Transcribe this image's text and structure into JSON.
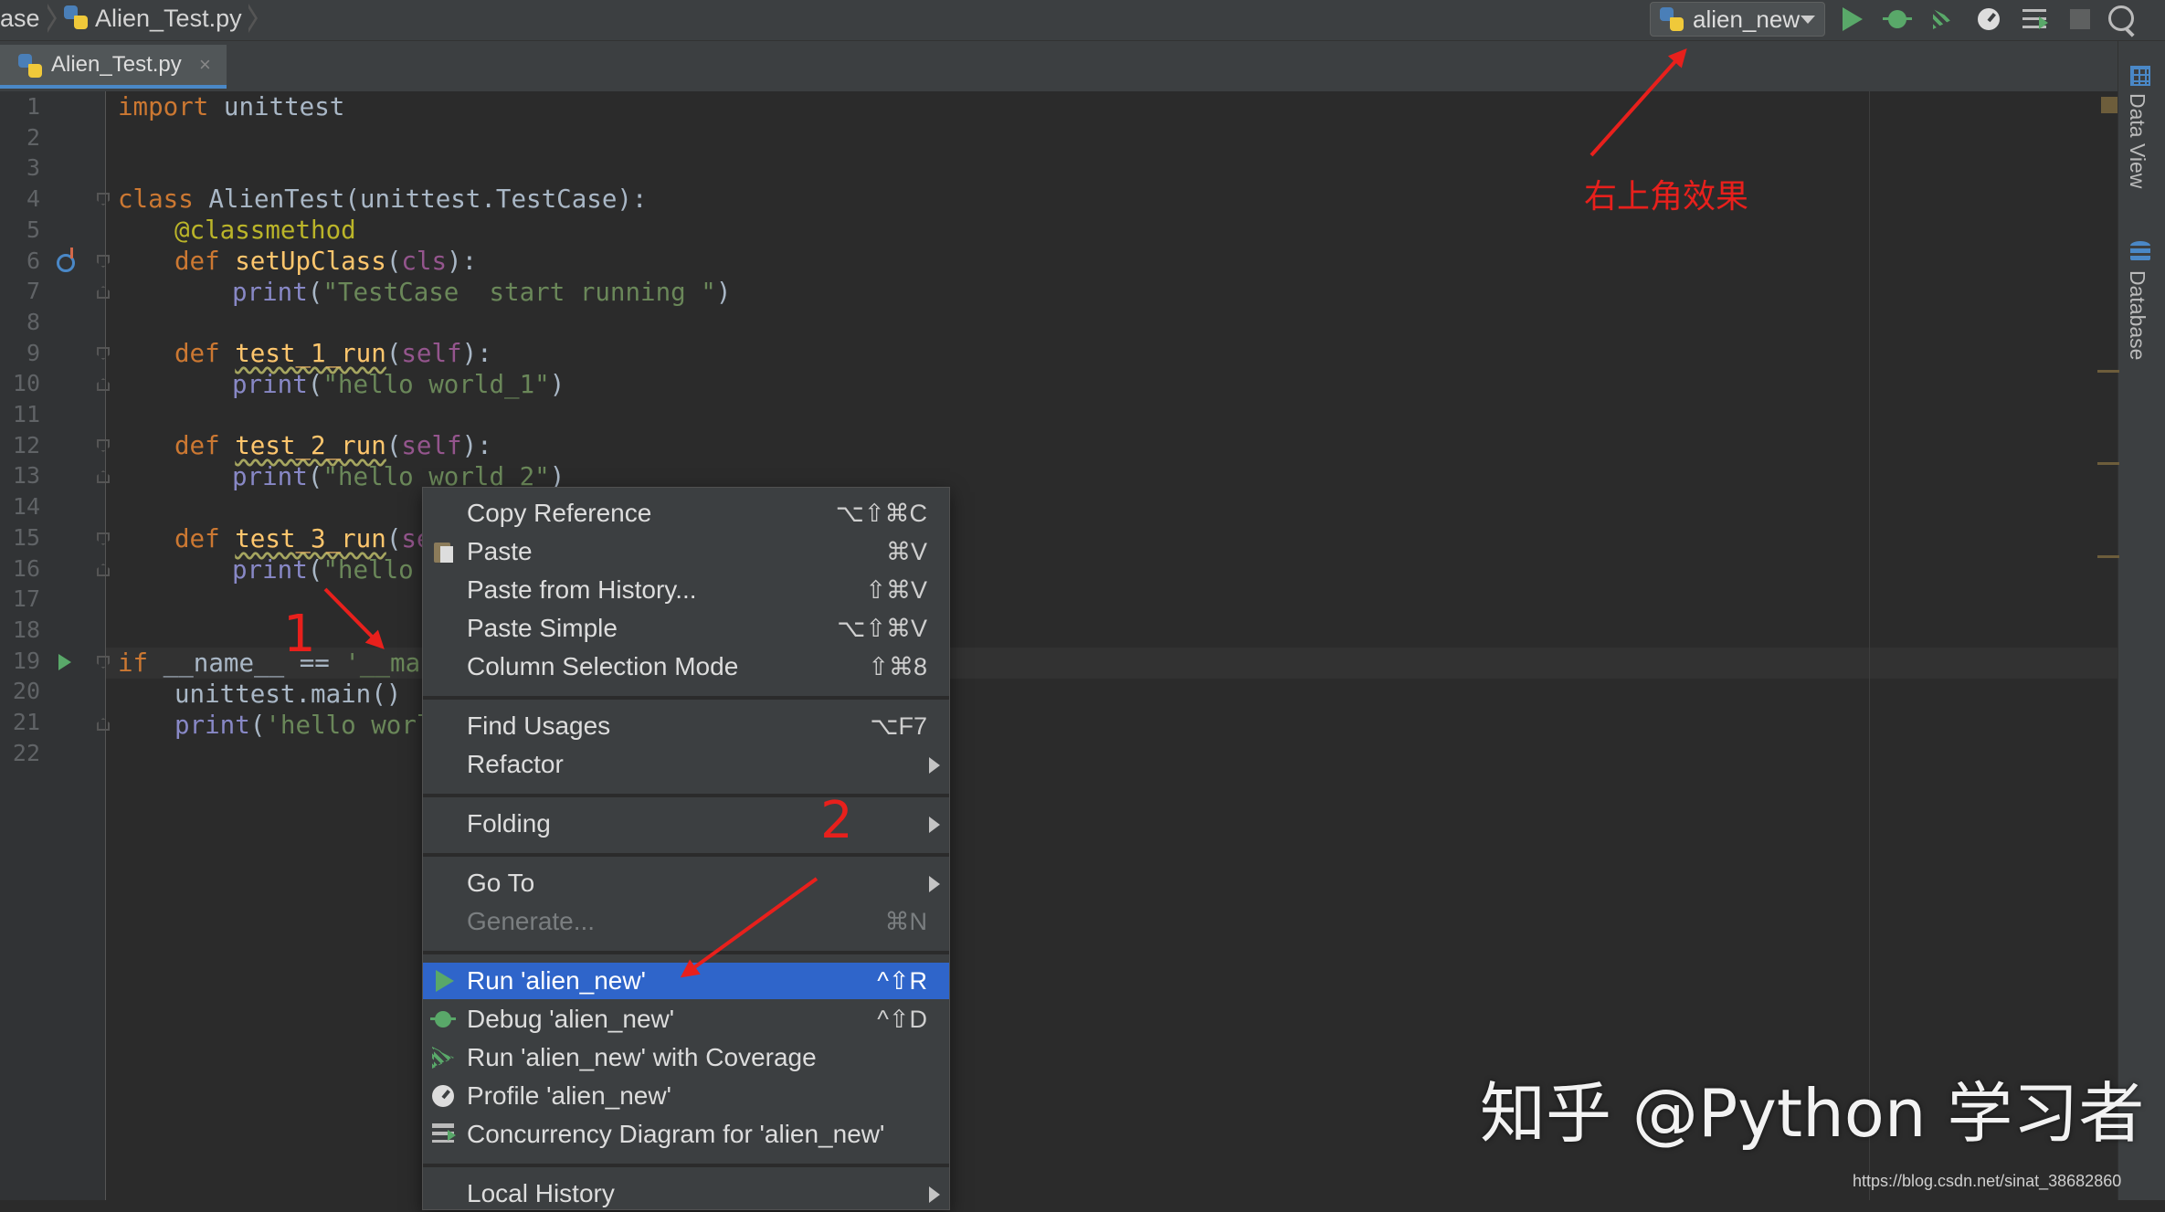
{
  "breadcrumb": {
    "prefix": "ase",
    "file": "Alien_Test.py"
  },
  "toolbar": {
    "run_config": "alien_new",
    "buttons": [
      "run-icon",
      "debug-icon",
      "coverage-icon",
      "profile-icon",
      "concurrency-icon",
      "stop-icon",
      "search-icon"
    ]
  },
  "tab": {
    "label": "Alien_Test.py",
    "close": "×"
  },
  "right_tool_windows": [
    "Data View",
    "Database"
  ],
  "line_numbers": [
    "1",
    "2",
    "3",
    "4",
    "5",
    "6",
    "7",
    "8",
    "9",
    "10",
    "11",
    "12",
    "13",
    "14",
    "15",
    "16",
    "17",
    "18",
    "19",
    "20",
    "21",
    "22"
  ],
  "code": {
    "l1_kw": "import",
    "l1_rest": " unittest",
    "l4_kw": "class",
    "l4_rest": " AlienTest(unittest.TestCase):",
    "l5_dec": "@classmethod",
    "l6_kw": "def ",
    "l6_fn": "setUpClass",
    "l6_p1": "(",
    "l6_arg": "cls",
    "l6_p2": "):",
    "l7_bi": "print",
    "l7_p1": "(",
    "l7_str": "\"TestCase  start running \"",
    "l7_p2": ")",
    "l9_kw": "def ",
    "l9_fn": "test_1_run",
    "l9_p1": "(",
    "l9_arg": "self",
    "l9_p2": "):",
    "l10_bi": "print",
    "l10_p1": "(",
    "l10_str": "\"hello world_1\"",
    "l10_p2": ")",
    "l12_kw": "def ",
    "l12_fn": "test_2_run",
    "l12_p1": "(",
    "l12_arg": "self",
    "l12_p2": "):",
    "l13_bi": "print",
    "l13_p1": "(",
    "l13_str": "\"hello world_2\"",
    "l13_p2": ")",
    "l15_kw": "def ",
    "l15_fn": "test_3_run",
    "l15_p1": "(",
    "l15_arg": "se",
    "l16_bi": "print",
    "l16_p1": "(",
    "l16_str": "\"hello",
    "l19_kw": "if",
    "l19_rest": " __name__ == ",
    "l19_str": "'__mai",
    "l20": "unittest.main()",
    "l21_bi": "print",
    "l21_p1": "(",
    "l21_str": "'hello worl"
  },
  "context_menu": {
    "items": [
      {
        "label": "Copy Reference",
        "shortcut": "⌥⇧⌘C"
      },
      {
        "label": "Paste",
        "shortcut": "⌘V",
        "icon": "paste-icon"
      },
      {
        "label": "Paste from History...",
        "shortcut": "⇧⌘V"
      },
      {
        "label": "Paste Simple",
        "shortcut": "⌥⇧⌘V"
      },
      {
        "label": "Column Selection Mode",
        "shortcut": "⇧⌘8"
      },
      {
        "label": "Find Usages",
        "shortcut": "⌥F7"
      },
      {
        "label": "Refactor",
        "submenu": true
      },
      {
        "label": "Folding",
        "submenu": true
      },
      {
        "label": "Go To",
        "submenu": true
      },
      {
        "label": "Generate...",
        "shortcut": "⌘N",
        "disabled": true
      },
      {
        "label": "Run 'alien_new'",
        "shortcut": "^⇧R",
        "selected": true,
        "icon": "run-icon"
      },
      {
        "label": "Debug 'alien_new'",
        "shortcut": "^⇧D",
        "icon": "debug-icon"
      },
      {
        "label": "Run 'alien_new' with Coverage",
        "icon": "coverage-icon"
      },
      {
        "label": "Profile 'alien_new'",
        "icon": "profile-icon"
      },
      {
        "label": "Concurrency Diagram for  'alien_new'",
        "icon": "concurrency-icon"
      },
      {
        "label": "Local History",
        "submenu": true
      }
    ]
  },
  "annotations": {
    "top_right_note": "右上角效果",
    "marker_1": "1",
    "marker_2": "2",
    "color": "#e8201c"
  },
  "watermark": "知乎 @Python 学习者",
  "source_url": "https://blog.csdn.net/sinat_38682860",
  "colors": {
    "accent": "#2f65ca",
    "run_green": "#59a869",
    "keyword": "#cc7832",
    "string": "#6a8759"
  }
}
